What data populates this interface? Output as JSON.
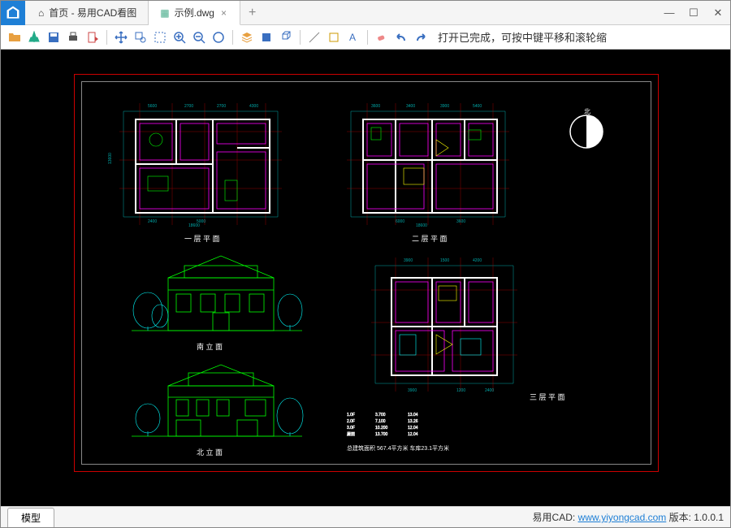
{
  "titlebar": {
    "tabs": [
      {
        "label": "首页 - 易用CAD看图",
        "icon": "home"
      },
      {
        "label": "示例.dwg",
        "icon": "drawing",
        "active": true
      }
    ],
    "newtab": "+"
  },
  "toolbar": {
    "status": "打开已完成，可按中键平移和滚轮缩"
  },
  "sheet_tab": "模型",
  "footer": {
    "brand": "易用CAD: ",
    "url": "www.yiyongcad.com",
    "version_label": " 版本: ",
    "version": "1.0.0.1"
  },
  "drawing": {
    "labels": {
      "floor1": "一 层 平 面",
      "floor2": "二 层 平 面",
      "floor3": "三 层 平 面",
      "elev_s": "南 立 面",
      "elev_n": "北 立 面",
      "compass": "北",
      "area_text": "总建筑面积   567.4平方米   车库23.1平方米"
    },
    "dims": {
      "w1": "18600",
      "w2": "18600",
      "h1": "13600",
      "d1": "5600",
      "d2": "2700",
      "d3": "2700",
      "d4": "4300",
      "d5": "3600",
      "d6": "3400",
      "d7": "2400",
      "d8": "5000",
      "d9": "3600",
      "d10": "3900",
      "d11": "5400",
      "d12": "6000",
      "d13": "1500",
      "d14": "3900",
      "d15": "4200",
      "d16": "3900",
      "d17": "1200",
      "d18": "2400"
    }
  }
}
